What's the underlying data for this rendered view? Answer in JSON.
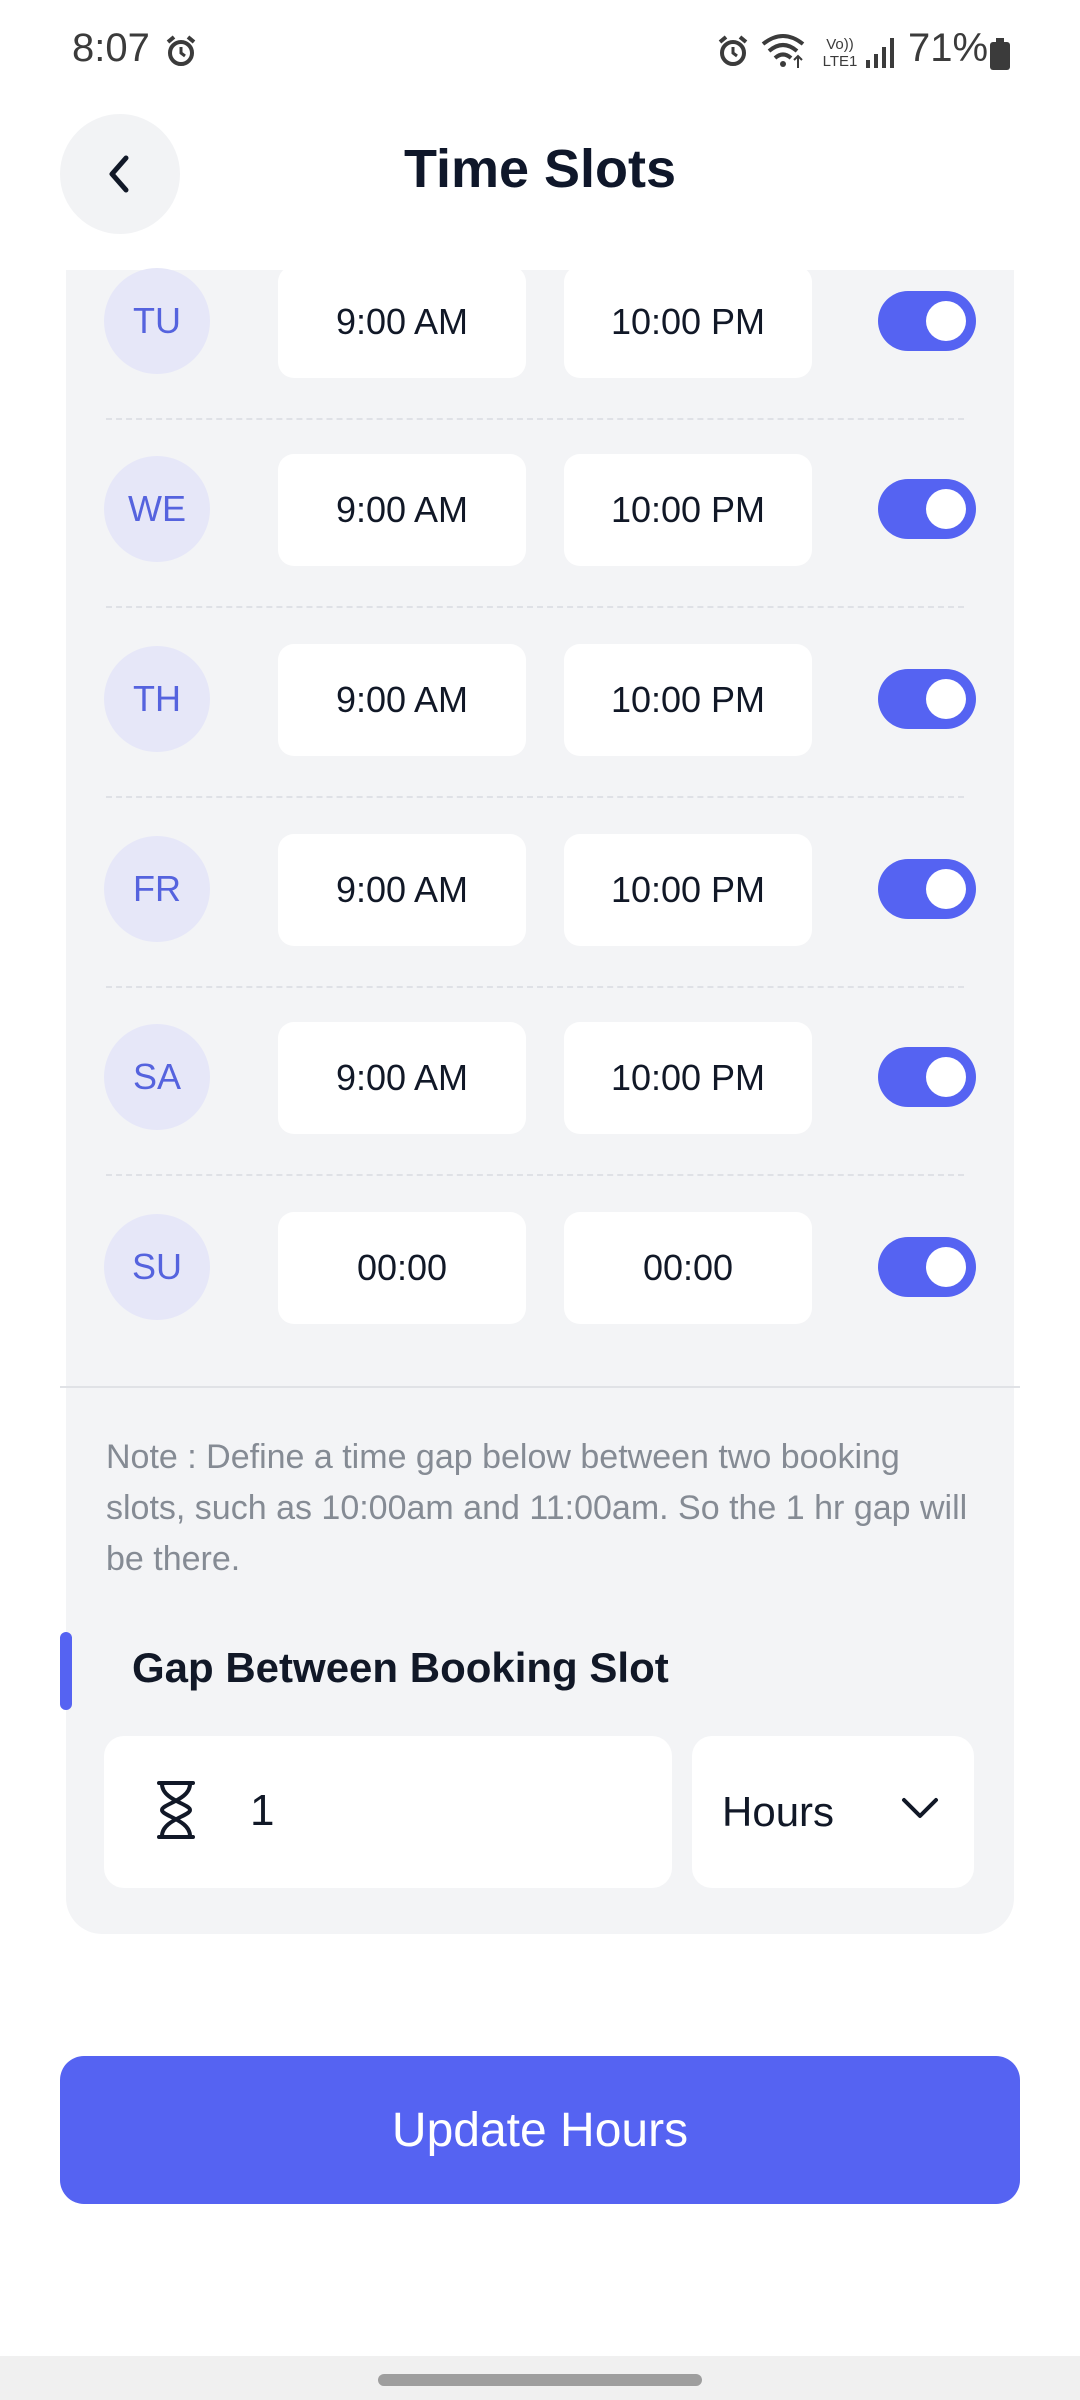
{
  "status_bar": {
    "time": "8:07",
    "battery": "71%",
    "icons": [
      "alarm-icon",
      "wifi-icon",
      "volte-icon",
      "signal-icon",
      "battery-icon"
    ],
    "volte_line1": "Vo))",
    "volte_line2": "LTE1"
  },
  "header": {
    "title": "Time Slots",
    "back_icon": "chevron-left-icon"
  },
  "schedule": [
    {
      "day": "TU",
      "start": "9:00 AM",
      "end": "10:00 PM",
      "enabled": true
    },
    {
      "day": "WE",
      "start": "9:00 AM",
      "end": "10:00 PM",
      "enabled": true
    },
    {
      "day": "TH",
      "start": "9:00 AM",
      "end": "10:00 PM",
      "enabled": true
    },
    {
      "day": "FR",
      "start": "9:00 AM",
      "end": "10:00 PM",
      "enabled": true
    },
    {
      "day": "SA",
      "start": "9:00 AM",
      "end": "10:00 PM",
      "enabled": true
    },
    {
      "day": "SU",
      "start": "00:00",
      "end": "00:00",
      "enabled": true
    }
  ],
  "note": "Note : Define a time gap below between two booking slots, such as 10:00am and 11:00am. So the 1 hr gap will be there.",
  "gap": {
    "label": "Gap Between Booking Slot",
    "value": "1",
    "unit": "Hours",
    "icon": "hourglass-icon"
  },
  "update_button": "Update Hours",
  "colors": {
    "accent": "#5563f2",
    "day_badge_bg": "#e6e7f8",
    "day_badge_text": "#5563de",
    "card_bg": "#f3f4f6"
  }
}
